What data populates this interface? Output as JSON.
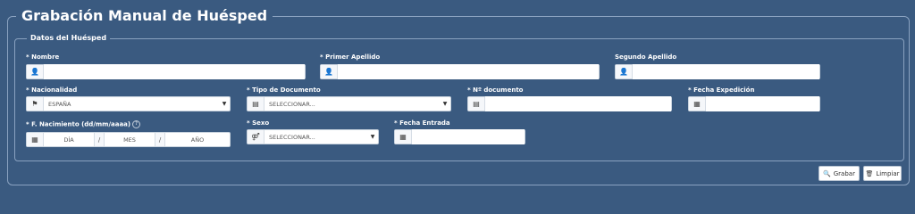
{
  "title": "Grabación Manual de Huésped",
  "section_title": "Datos del Huésped",
  "fields": {
    "nombre": {
      "label": "* Nombre",
      "value": ""
    },
    "primer_apellido": {
      "label": "* Primer Apellido",
      "value": ""
    },
    "segundo_apellido": {
      "label": "Segundo Apellido",
      "value": ""
    },
    "nacionalidad": {
      "label": "* Nacionalidad",
      "value": "ESPAÑA"
    },
    "tipo_documento": {
      "label": "* Tipo de Documento",
      "value": "SELECCIONAR..."
    },
    "n_documento": {
      "label": "* Nº documento",
      "value": ""
    },
    "fecha_expedicion": {
      "label": "* Fecha Expedición",
      "value": ""
    },
    "fecha_nacimiento": {
      "label": "* F. Nacimiento (dd/mm/aaaa)",
      "dia": "DÍA",
      "mes": "MES",
      "anio": "AÑO",
      "sep": "/"
    },
    "sexo": {
      "label": "* Sexo",
      "value": "SELECCIONAR..."
    },
    "fecha_entrada": {
      "label": "* Fecha Entrada",
      "value": ""
    }
  },
  "buttons": {
    "grabar": "Grabar",
    "limpiar": "Limpiar"
  },
  "icons": [
    "user-icon",
    "flag-icon",
    "id-card-icon",
    "calendar-icon",
    "gender-icon",
    "search-icon",
    "trash-icon",
    "help-icon"
  ]
}
